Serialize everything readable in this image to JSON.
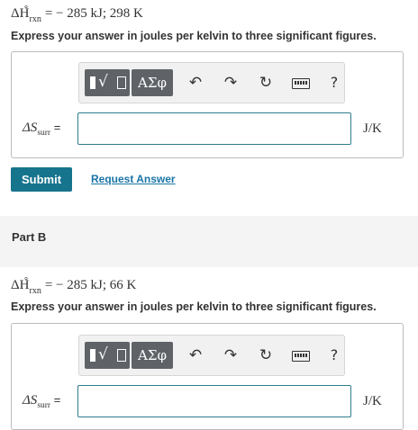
{
  "part_a": {
    "given_prefix": "ΔH",
    "given_sub": "rxn",
    "given_sup": "∘",
    "given_value": " = − 285 kJ; 298 K",
    "instruction": "Express your answer in joules per kelvin to three significant figures.",
    "answer_label_main": "ΔS",
    "answer_label_sub": "surr",
    "answer_label_eq": " =",
    "answer_value": "",
    "unit": "J/K",
    "submit_label": "Submit",
    "request_answer_label": "Request Answer"
  },
  "part_b": {
    "title": "Part B",
    "given_prefix": "ΔH",
    "given_sub": "rxn",
    "given_sup": "∘",
    "given_value": " = − 285 kJ; 66 K",
    "instruction": "Express your answer in joules per kelvin to three significant figures.",
    "answer_label_main": "ΔS",
    "answer_label_sub": "surr",
    "answer_label_eq": " =",
    "answer_value": "",
    "unit": "J/K"
  },
  "toolbar": {
    "greek_label": "ΑΣφ",
    "undo_icon": "↶",
    "redo_icon": "↷",
    "reset_icon": "↻",
    "help_label": "?"
  }
}
